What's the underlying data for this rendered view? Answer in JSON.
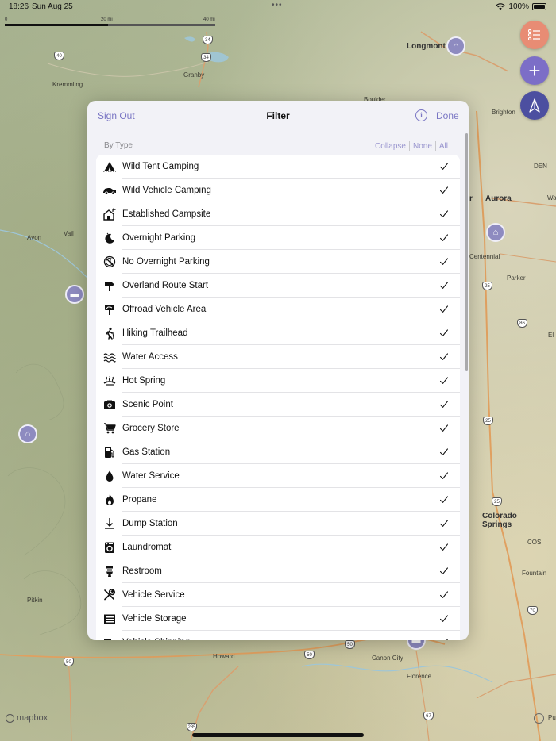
{
  "status_bar": {
    "time": "18:26",
    "date": "Sun Aug 25",
    "battery": "100%",
    "icons": [
      "wifi-icon",
      "battery-icon"
    ]
  },
  "scale": {
    "start": "0",
    "mid": "20 mi",
    "end": "40 mi"
  },
  "map": {
    "labels": {
      "longmont": "Longmont",
      "granby": "Granby",
      "kremmling": "Kremmling",
      "brighton": "Brighton",
      "aurora": "Aurora",
      "centennial": "Centennial",
      "parker": "Parker",
      "vail": "Vail",
      "avon": "Avon",
      "colorado_springs": "Colorado Springs",
      "fountain": "Fountain",
      "pitkin": "Pitkin",
      "howard": "Howard",
      "canon_city": "Canon City",
      "florence": "Florence",
      "boulder_partial": "Boulder",
      "den": "DEN",
      "cos": "COS",
      "pueblo_partial": "Pu",
      "wa_partial": "Wa",
      "el_partial": "El",
      "r_partial": "r"
    },
    "shields": {
      "s34a": "34",
      "s34b": "34",
      "s40": "40",
      "s86": "86",
      "s25a": "25",
      "s25b": "25",
      "s25c": "25",
      "s50a": "50",
      "s50b": "50",
      "s50c": "50",
      "s285": "285",
      "s67": "67",
      "s70": "70"
    }
  },
  "fab": {
    "add_label": "+"
  },
  "attribution": {
    "mapbox": "mapbox",
    "info": "i"
  },
  "sheet": {
    "sign_out": "Sign Out",
    "title": "Filter",
    "info": "i",
    "done": "Done",
    "section_label": "By Type",
    "collapse": "Collapse",
    "none": "None",
    "all": "All",
    "items": [
      {
        "label": "Wild Tent Camping",
        "icon": "tent-icon",
        "checked": true
      },
      {
        "label": "Wild Vehicle Camping",
        "icon": "car-icon",
        "checked": true
      },
      {
        "label": "Established Campsite",
        "icon": "campsite-icon",
        "checked": true
      },
      {
        "label": "Overnight Parking",
        "icon": "moon-icon",
        "checked": true
      },
      {
        "label": "No Overnight Parking",
        "icon": "no-parking-icon",
        "checked": true
      },
      {
        "label": "Overland Route Start",
        "icon": "signpost-icon",
        "checked": true
      },
      {
        "label": "Offroad Vehicle Area",
        "icon": "offroad-sign-icon",
        "checked": true
      },
      {
        "label": "Hiking Trailhead",
        "icon": "hiker-icon",
        "checked": true
      },
      {
        "label": "Water Access",
        "icon": "waves-icon",
        "checked": true
      },
      {
        "label": "Hot Spring",
        "icon": "hot-spring-icon",
        "checked": true
      },
      {
        "label": "Scenic Point",
        "icon": "camera-icon",
        "checked": true
      },
      {
        "label": "Grocery Store",
        "icon": "cart-icon",
        "checked": true
      },
      {
        "label": "Gas Station",
        "icon": "fuel-pump-icon",
        "checked": true
      },
      {
        "label": "Water Service",
        "icon": "droplet-icon",
        "checked": true
      },
      {
        "label": "Propane",
        "icon": "flame-icon",
        "checked": true
      },
      {
        "label": "Dump Station",
        "icon": "dump-icon",
        "checked": true
      },
      {
        "label": "Laundromat",
        "icon": "washer-icon",
        "checked": true
      },
      {
        "label": "Restroom",
        "icon": "restroom-icon",
        "checked": true
      },
      {
        "label": "Vehicle Service",
        "icon": "wrench-icon",
        "checked": true
      },
      {
        "label": "Vehicle Storage",
        "icon": "garage-icon",
        "checked": true
      },
      {
        "label": "Vehicle Shipping",
        "icon": "shipping-icon",
        "checked": true
      }
    ]
  }
}
